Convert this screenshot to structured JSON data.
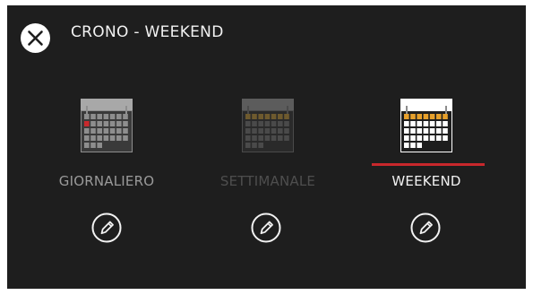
{
  "header": {
    "title": "CRONO - WEEKEND",
    "close_icon": "close-icon"
  },
  "modes": [
    {
      "id": "daily",
      "label": "GIORNALIERO",
      "state": "inactive",
      "icon": "calendar-daily-icon"
    },
    {
      "id": "weekly",
      "label": "SETTIMANALE",
      "state": "disabled",
      "icon": "calendar-weekly-icon"
    },
    {
      "id": "weekend",
      "label": "WEEKEND",
      "state": "selected",
      "icon": "calendar-weekend-icon"
    }
  ],
  "edit_icon": "pencil-icon",
  "colors": {
    "background": "#1e1e1e",
    "text_primary": "#f2f2f2",
    "text_inactive": "#9a9a9a",
    "text_disabled": "#4e4e4e",
    "accent": "#c8282c",
    "weekend_day": "#e7a02b",
    "weekly_day": "#6e5a2e"
  }
}
